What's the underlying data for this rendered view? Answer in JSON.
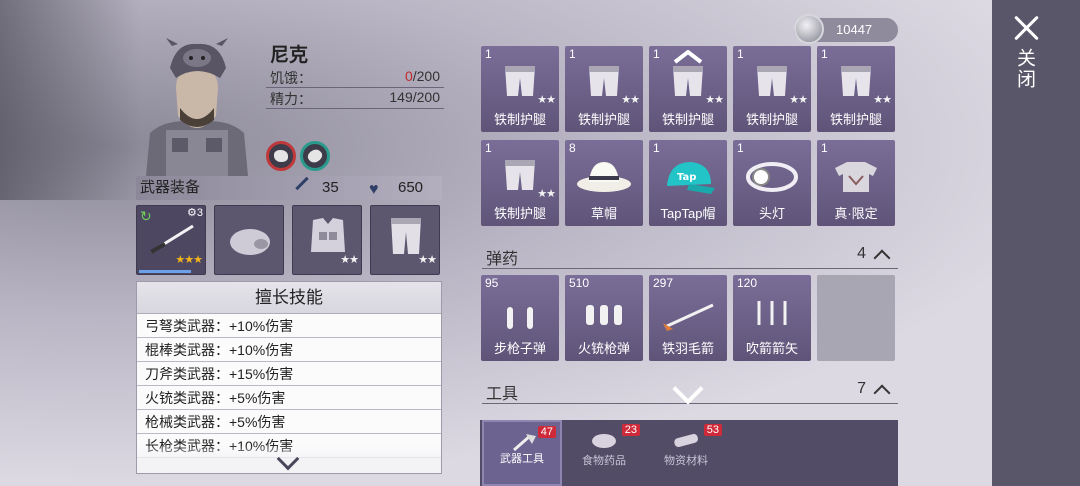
{
  "currency": {
    "amount": "10447"
  },
  "close": {
    "label": "关闭"
  },
  "character": {
    "name": "尼克",
    "hunger_label": "饥饿：",
    "hunger_current": "0",
    "hunger_max": "/200",
    "energy_label": "精力：",
    "energy_value": "149/200"
  },
  "equipment": {
    "title": "武器装备",
    "attack": "35",
    "health": "650",
    "slots": [
      {
        "name": "weapon",
        "badge": "3",
        "stars": "★★★",
        "selected": true
      },
      {
        "name": "helmet",
        "stars": ""
      },
      {
        "name": "armor",
        "stars": "★★"
      },
      {
        "name": "legs",
        "stars": "★★"
      }
    ]
  },
  "skills": {
    "title": "擅长技能",
    "items": [
      "弓弩类武器：+10%伤害",
      "棍棒类武器：+10%伤害",
      "刀斧类武器：+15%伤害",
      "火铳类武器：+5%伤害",
      "枪械类武器：+5%伤害",
      "长枪类武器：+10%伤害"
    ]
  },
  "inventory": {
    "row1": [
      {
        "count": "1",
        "name": "铁制护腿",
        "stars": "★★"
      },
      {
        "count": "1",
        "name": "铁制护腿",
        "stars": "★★"
      },
      {
        "count": "1",
        "name": "铁制护腿",
        "stars": "★★"
      },
      {
        "count": "1",
        "name": "铁制护腿",
        "stars": "★★"
      },
      {
        "count": "1",
        "name": "铁制护腿",
        "stars": "★★"
      }
    ],
    "row2": [
      {
        "count": "1",
        "name": "铁制护腿",
        "stars": "★★"
      },
      {
        "count": "8",
        "name": "草帽",
        "stars": ""
      },
      {
        "count": "1",
        "name": "TapTap帽",
        "stars": ""
      },
      {
        "count": "1",
        "name": "头灯",
        "stars": ""
      },
      {
        "count": "1",
        "name": "真·限定",
        "stars": ""
      }
    ],
    "ammo_section": {
      "title": "弹药",
      "count": "4"
    },
    "ammo": [
      {
        "count": "95",
        "name": "步枪子弹"
      },
      {
        "count": "510",
        "name": "火铳枪弹"
      },
      {
        "count": "297",
        "name": "铁羽毛箭"
      },
      {
        "count": "120",
        "name": "吹箭箭矢"
      }
    ],
    "tools_section": {
      "title": "工具",
      "count": "7"
    }
  },
  "tabs": [
    {
      "label": "武器工具",
      "badge": "47",
      "active": true
    },
    {
      "label": "食物药品",
      "badge": "23",
      "active": false
    },
    {
      "label": "物资材料",
      "badge": "53",
      "active": false
    }
  ]
}
